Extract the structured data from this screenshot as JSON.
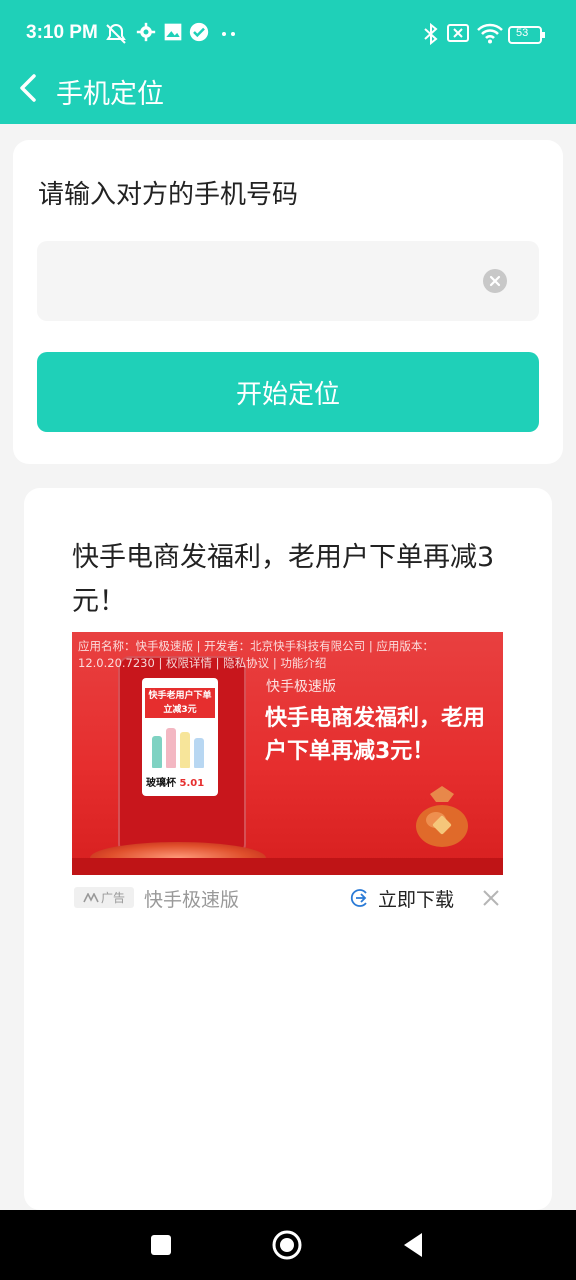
{
  "status_bar": {
    "time": "3:10 PM",
    "battery": "53",
    "icons_left": [
      "mute-icon",
      "gear-icon",
      "gallery-icon",
      "check-icon",
      "more-dots-icon"
    ],
    "icons_right": [
      "bluetooth-icon",
      "sim-off-icon",
      "wifi-icon",
      "battery-icon"
    ]
  },
  "nav": {
    "title": "手机定位"
  },
  "phone_form": {
    "label": "请输入对方的手机号码",
    "input_value": "",
    "input_placeholder": "",
    "button_label": "开始定位"
  },
  "ad": {
    "title": "快手电商发福利，老用户下单再减3元！",
    "banner": {
      "meta": "应用名称：快手极速版 | 开发者：北京快手科技有限公司 | 应用版本：12.0.20.7230 | 权限详情 | 隐私协议 | 功能介绍",
      "brand": "快手极速版",
      "headline": "快手电商发福利，老用户下单再减3元！",
      "phone_head": "快手老用户下单立减3元",
      "phone_foot_label": "玻璃杯",
      "phone_foot_price": "5.01"
    },
    "tag": "广告",
    "app_name": "快手极速版",
    "download_label": "立即下载"
  },
  "colors": {
    "accent": "#1fd0b8",
    "ad_red": "#e62e2e"
  }
}
